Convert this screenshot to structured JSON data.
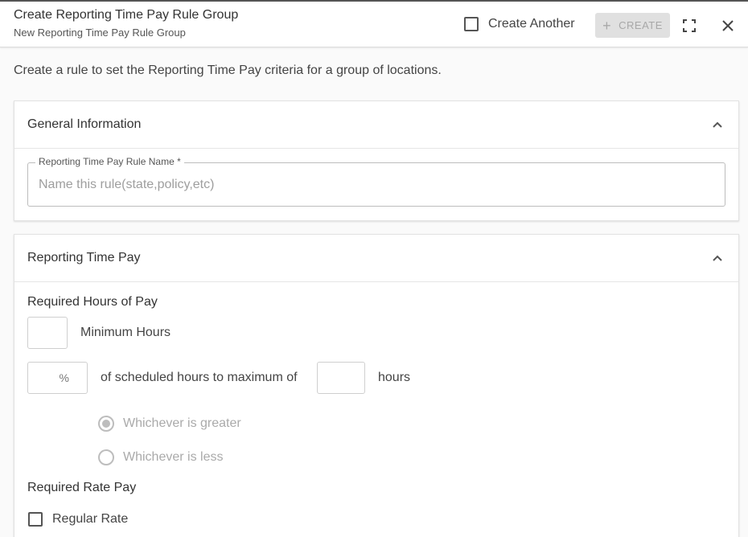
{
  "header": {
    "title": "Create Reporting Time Pay Rule Group",
    "subtitle": "New Reporting Time Pay Rule Group",
    "create_another_label": "Create Another",
    "create_another_checked": false,
    "create_label": "CREATE",
    "create_enabled": false
  },
  "intro_text": "Create a rule to set the Reporting Time Pay criteria for a group of locations.",
  "general_info": {
    "title": "General Information",
    "rule_name_label": "Reporting Time Pay Rule Name *",
    "rule_name_placeholder": "Name this rule(state,policy,etc)",
    "rule_name_value": ""
  },
  "reporting_time_pay": {
    "title": "Reporting Time Pay",
    "required_hours_label": "Required Hours of Pay",
    "minimum_hours_value": "",
    "minimum_hours_label": "Minimum Hours",
    "percent_value": "",
    "percent_symbol": "%",
    "scheduled_hours_text": "of scheduled hours to maximum of",
    "max_hours_value": "",
    "hours_text": "hours",
    "options": [
      {
        "label": "Whichever is greater",
        "selected": true,
        "disabled": true
      },
      {
        "label": "Whichever is less",
        "selected": false,
        "disabled": true
      }
    ],
    "required_rate_label": "Required Rate Pay",
    "regular_rate_label": "Regular Rate",
    "regular_rate_checked": false
  },
  "colors": {
    "accent_border": "#555555",
    "disabled_button_bg": "#e0e0e0",
    "disabled_text": "#a8a8a8"
  },
  "icons": [
    "plus-icon",
    "fullscreen-icon",
    "close-icon",
    "chevron-up-icon"
  ]
}
